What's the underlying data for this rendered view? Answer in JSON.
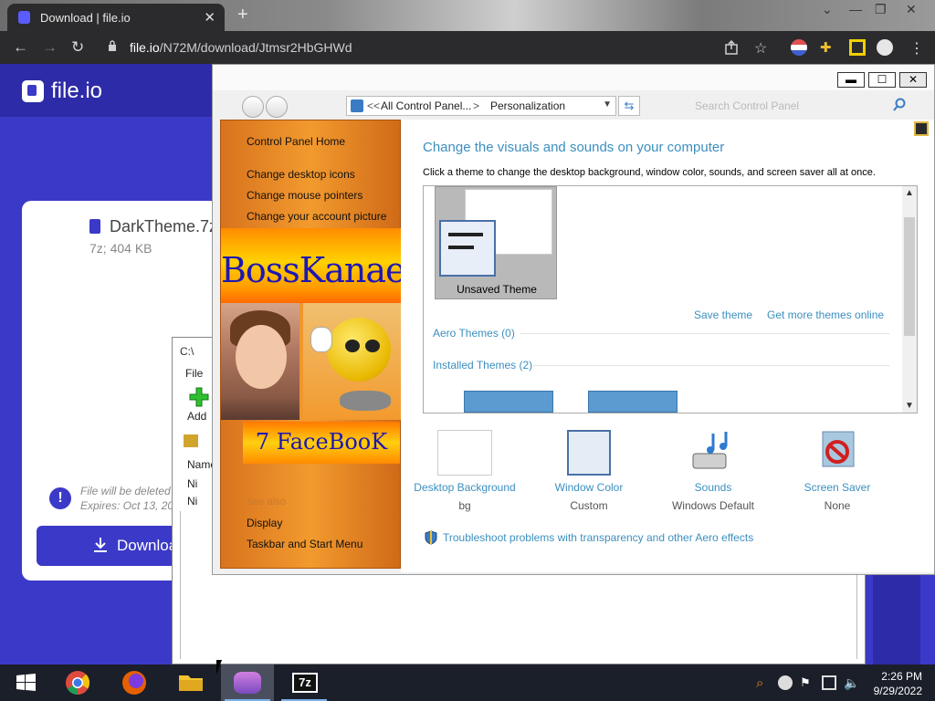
{
  "browser": {
    "tab_title": "Download | file.io",
    "url_domain": "file.io",
    "url_path": "/N72M/download/Jtmsr2HbGHWd"
  },
  "fileio": {
    "logo": "file.io",
    "file_name": "DarkTheme.7z",
    "file_meta": "7z; 404 KB",
    "info_text": "File will be deleted\nExpires: Oct 13, 20",
    "download_label": "Downloa"
  },
  "zip": {
    "title": "C:\\",
    "menu_file": "File",
    "add_label": "Add",
    "name_col": "Name",
    "row1": "Ni",
    "row2": "Ni"
  },
  "cp": {
    "breadcrumb_root": "All Control Panel...",
    "breadcrumb_sep": ">",
    "breadcrumb_back": "<<",
    "breadcrumb_current": "Personalization",
    "search_placeholder": "Search Control Panel",
    "sidebar": {
      "home": "Control Panel Home",
      "links": [
        "Change desktop icons",
        "Change mouse pointers",
        "Change your account picture"
      ],
      "banner1": "BossKanae",
      "banner2": "7 FaceBooK",
      "see_also": "See also",
      "see_also_links": [
        "Display",
        "Taskbar and Start Menu"
      ]
    },
    "heading": "Change the visuals and sounds on your computer",
    "subheading": "Click a theme to change the desktop background, window color, sounds, and screen saver all at once.",
    "unsaved_theme": "Unsaved Theme",
    "save_theme": "Save theme",
    "get_more": "Get more themes online",
    "aero_themes": "Aero Themes (0)",
    "installed_themes": "Installed Themes (2)",
    "options": [
      {
        "label": "Desktop Background",
        "value": "bg"
      },
      {
        "label": "Window Color",
        "value": "Custom"
      },
      {
        "label": "Sounds",
        "value": "Windows Default"
      },
      {
        "label": "Screen Saver",
        "value": "None"
      }
    ],
    "troubleshoot": "Troubleshoot problems with transparency and other Aero effects"
  },
  "taskbar": {
    "time": "2:26 PM",
    "date": "9/29/2022",
    "zip_label": "7z"
  }
}
